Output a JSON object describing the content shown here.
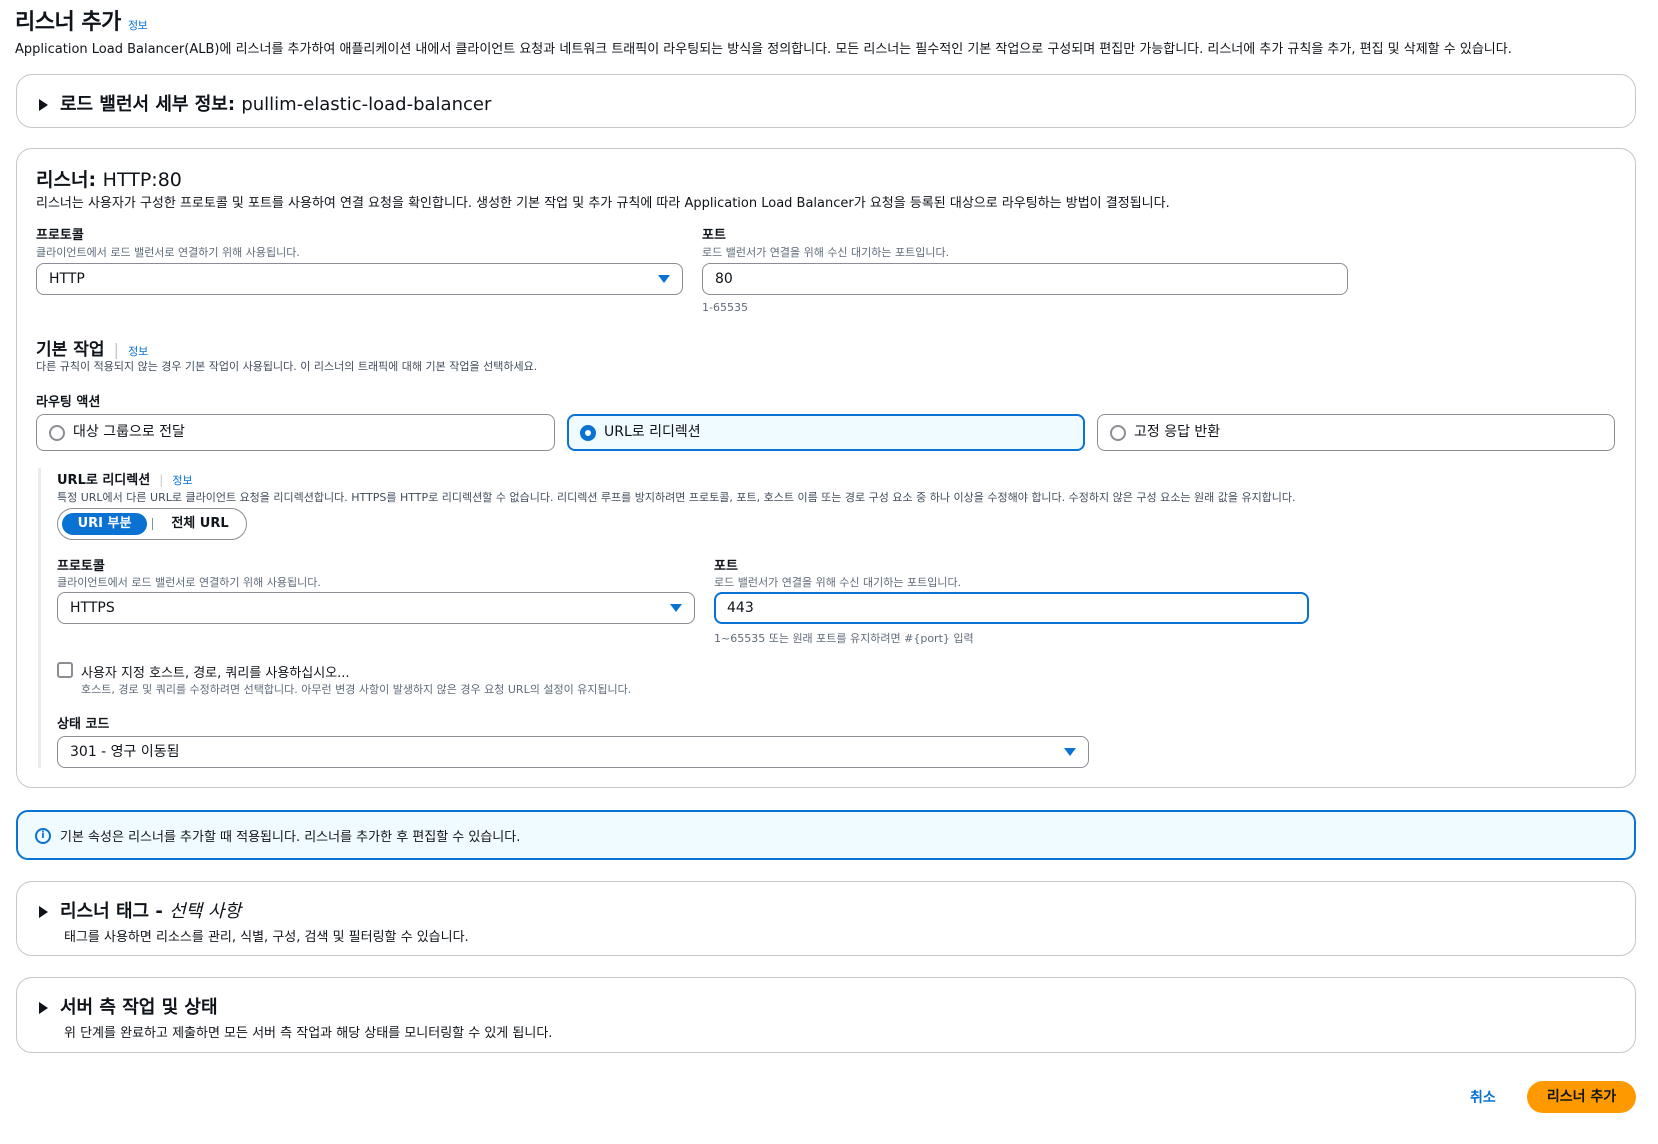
{
  "header": {
    "title": "리스너 추가",
    "info_link": "정보",
    "description": "Application Load Balancer(ALB)에 리스너를 추가하여 애플리케이션 내에서 클라이언트 요청과 네트워크 트래픽이 라우팅되는 방식을 정의합니다. 모든 리스너는 필수적인 기본 작업으로 구성되며 편집만 가능합니다. 리스너에 추가 규칙을 추가, 편집 및 삭제할 수 있습니다."
  },
  "lb_details": {
    "label": "로드 밸런서 세부 정보:",
    "value": "pullim-elastic-load-balancer"
  },
  "listener": {
    "title_label": "리스너:",
    "title_value": "HTTP:80",
    "description": "리스너는 사용자가 구성한 프로토콜 및 포트를 사용하여 연결 요청을 확인합니다. 생성한 기본 작업 및 추가 규칙에 따라 Application Load Balancer가 요청을 등록된 대상으로 라우팅하는 방법이 결정됩니다.",
    "protocol": {
      "label": "프로토콜",
      "hint": "클라이언트에서 로드 밸런서로 연결하기 위해 사용됩니다.",
      "value": "HTTP"
    },
    "port": {
      "label": "포트",
      "hint": "로드 밸런서가 연결을 위해 수신 대기하는 포트입니다.",
      "value": "80",
      "constraint": "1-65535"
    }
  },
  "default_action": {
    "title": "기본 작업",
    "info_link": "정보",
    "description": "다른 규칙이 적용되지 않는 경우 기본 작업이 사용됩니다. 이 리스너의 트래픽에 대해 기본 작업을 선택하세요.",
    "routing_label": "라우팅 액션",
    "options": [
      {
        "label": "대상 그룹으로 전달",
        "selected": false
      },
      {
        "label": "URL로 리디렉션",
        "selected": true
      },
      {
        "label": "고정 응답 반환",
        "selected": false
      }
    ]
  },
  "redirect": {
    "title": "URL로 리디렉션",
    "info_link": "정보",
    "description": "특정 URL에서 다른 URL로 클라이언트 요청을 리디렉션합니다. HTTPS를 HTTP로 리디렉션할 수 없습니다. 리디렉션 루프를 방지하려면 프로토콜, 포트, 호스트 이름 또는 경로 구성 요소 중 하나 이상을 수정해야 합니다. 수정하지 않은 구성 요소는 원래 값을 유지합니다.",
    "segment": {
      "selected": "URI 부분",
      "other": "전체 URL"
    },
    "protocol": {
      "label": "프로토콜",
      "hint": "클라이언트에서 로드 밸런서로 연결하기 위해 사용됩니다.",
      "value": "HTTPS"
    },
    "port": {
      "label": "포트",
      "hint": "로드 밸런서가 연결을 위해 수신 대기하는 포트입니다.",
      "value": "443",
      "constraint": "1~65535 또는 원래 포트를 유지하려면 #{port} 입력"
    },
    "custom": {
      "label": "사용자 지정 호스트, 경로, 쿼리를 사용하십시오...",
      "hint": "호스트, 경로 및 쿼리를 수정하려면 선택합니다. 아무런 변경 사항이 발생하지 않은 경우 요청 URL의 설정이 유지됩니다.",
      "checked": false
    },
    "status_code": {
      "label": "상태 코드",
      "value": "301 - 영구 이동됨"
    }
  },
  "alert": {
    "text": "기본 속성은 리스너를 추가할 때 적용됩니다. 리스너를 추가한 후 편집할 수 있습니다."
  },
  "tags": {
    "title": "리스너 태그 -",
    "optional": "선택 사항",
    "description": "태그를 사용하면 리소스를 관리, 식별, 구성, 검색 및 필터링할 수 있습니다."
  },
  "server_side": {
    "title": "서버 측 작업 및 상태",
    "description": "위 단계를 완료하고 제출하면 모든 서버 측 작업과 해당 상태를 모니터링할 수 있게 됩니다."
  },
  "footer": {
    "cancel": "취소",
    "submit": "리스너 추가"
  },
  "colors": {
    "accent": "#0972d3",
    "primary_button": "#ff9900",
    "border": "#c6c6cd"
  }
}
